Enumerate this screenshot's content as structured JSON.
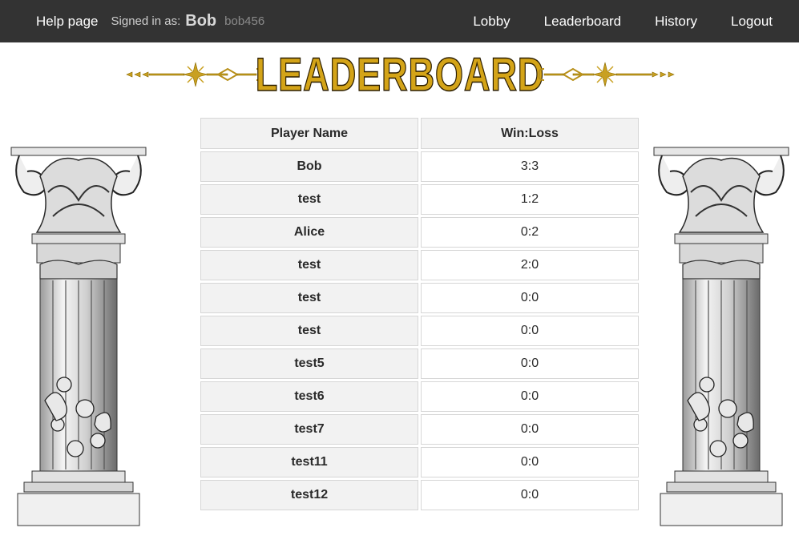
{
  "nav": {
    "help": "Help page",
    "signed_in_label": "Signed in as:",
    "username": "Bob",
    "user_id": "bob456",
    "links": [
      "Lobby",
      "Leaderboard",
      "History",
      "Logout"
    ]
  },
  "page": {
    "title": "LEADERBOARD"
  },
  "table": {
    "headers": [
      "Player Name",
      "Win:Loss"
    ],
    "rows": [
      {
        "name": "Bob",
        "wl": "3:3"
      },
      {
        "name": "test",
        "wl": "1:2"
      },
      {
        "name": "Alice",
        "wl": "0:2"
      },
      {
        "name": "test",
        "wl": "2:0"
      },
      {
        "name": "test",
        "wl": "0:0"
      },
      {
        "name": "test",
        "wl": "0:0"
      },
      {
        "name": "test5",
        "wl": "0:0"
      },
      {
        "name": "test6",
        "wl": "0:0"
      },
      {
        "name": "test7",
        "wl": "0:0"
      },
      {
        "name": "test11",
        "wl": "0:0"
      },
      {
        "name": "test12",
        "wl": "0:0"
      }
    ]
  },
  "colors": {
    "navbar": "#333333",
    "title_gold": "#d4a418",
    "cell_gray": "#f2f2f2"
  },
  "icons": [
    "ornament-left-icon",
    "ornament-right-icon",
    "corinthian-pillar-left",
    "corinthian-pillar-right"
  ]
}
